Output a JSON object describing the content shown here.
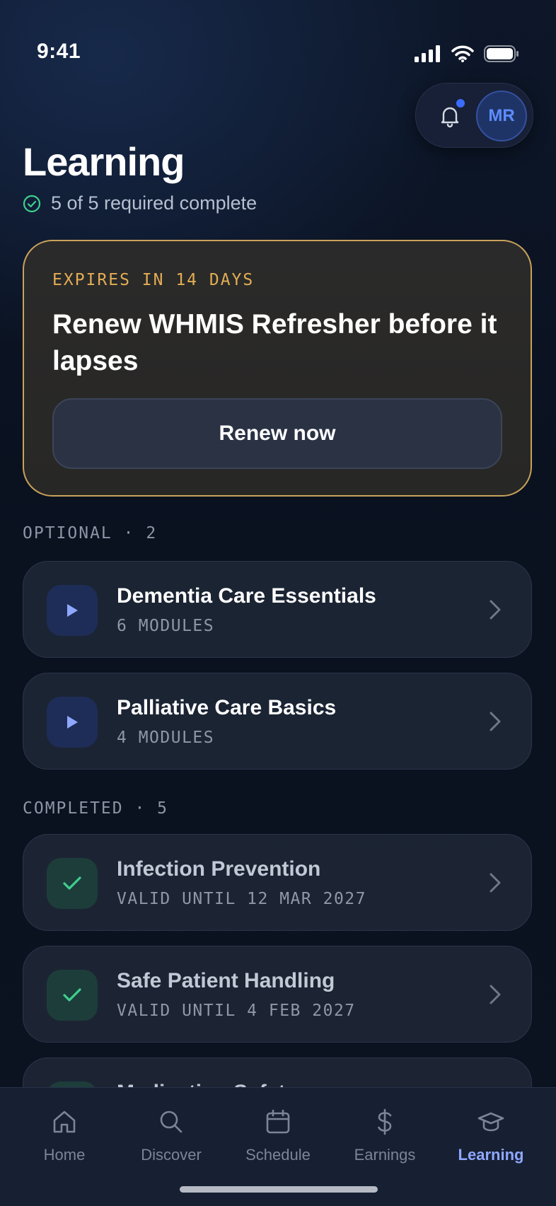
{
  "status_bar": {
    "time": "9:41"
  },
  "header": {
    "avatar_initials": "MR",
    "has_notification": true
  },
  "page": {
    "title": "Learning",
    "progress_text": "5 of 5 required complete"
  },
  "alert": {
    "eyebrow": "EXPIRES IN 14 DAYS",
    "title": "Renew WHMIS Refresher before it lapses",
    "button_label": "Renew now",
    "accent_color": "#e3ad54"
  },
  "optional": {
    "label": "OPTIONAL · 2",
    "items": [
      {
        "title": "Dementia Care Essentials",
        "subtitle": "6 MODULES"
      },
      {
        "title": "Palliative Care Basics",
        "subtitle": "4 MODULES"
      }
    ]
  },
  "completed": {
    "label": "COMPLETED · 5",
    "items": [
      {
        "title": "Infection Prevention",
        "subtitle": "VALID UNTIL 12 MAR 2027"
      },
      {
        "title": "Safe Patient Handling",
        "subtitle": "VALID UNTIL 4 FEB 2027"
      },
      {
        "title": "Medication Safety",
        "subtitle": ""
      }
    ]
  },
  "tab_bar": {
    "active": "Learning",
    "tabs": [
      {
        "label": "Home",
        "icon": "home-icon"
      },
      {
        "label": "Discover",
        "icon": "search-icon"
      },
      {
        "label": "Schedule",
        "icon": "calendar-icon"
      },
      {
        "label": "Earnings",
        "icon": "dollar-icon"
      },
      {
        "label": "Learning",
        "icon": "graduation-cap-icon"
      }
    ]
  },
  "colors": {
    "accent_blue": "#8fa8ff",
    "success_green": "#3ecf8e",
    "alert_border": "#c9a25a"
  }
}
